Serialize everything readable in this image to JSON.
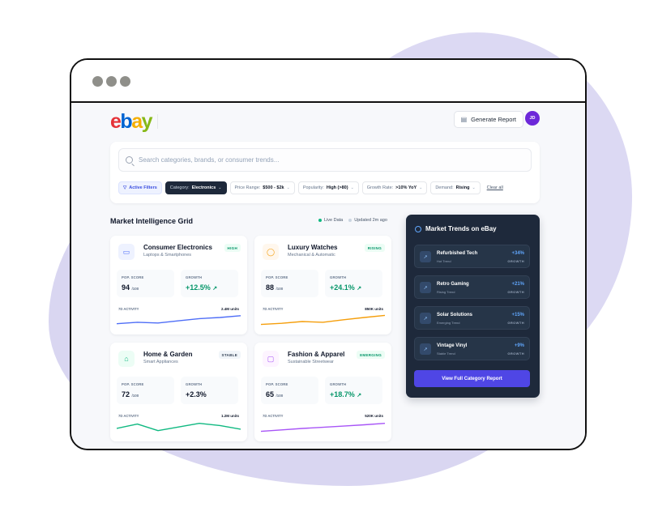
{
  "header": {
    "logo": {
      "e": "e",
      "b": "b",
      "a": "a",
      "y": "y"
    },
    "generate_report_label": "Generate Report",
    "avatar_initials": "JD"
  },
  "search": {
    "placeholder": "Search categories, brands, or consumer trends..."
  },
  "filters": {
    "active_label": "Active Filters",
    "items": [
      {
        "key": "Category:",
        "value": "Electronics"
      },
      {
        "key": "Price Range:",
        "value": "$500 - $2k"
      },
      {
        "key": "Popularity:",
        "value": "High (>80)"
      },
      {
        "key": "Growth Rate:",
        "value": ">10% YoY"
      },
      {
        "key": "Demand:",
        "value": "Rising"
      }
    ],
    "clear_label": "Clear all"
  },
  "grid": {
    "title": "Market Intelligence Grid",
    "live_label": "Live Data",
    "updated_label": "Updated 2m ago",
    "cards": [
      {
        "name": "Consumer Electronics",
        "sub": "Laptops & Smartphones",
        "badge": "HIGH",
        "pop_label": "POP. SCORE",
        "pop": "94",
        "pop_unit": "/100",
        "growth_label": "GROWTH",
        "growth": "+12.5%",
        "activity_label": "7D ACTIVITY",
        "activity": "2.4M units",
        "trend": [
          0.35,
          0.45,
          0.4,
          0.55,
          0.7,
          0.78,
          0.9
        ],
        "color": "#4f6ef7"
      },
      {
        "name": "Luxury Watches",
        "sub": "Mechanical & Automatic",
        "badge": "RISING",
        "pop_label": "POP. SCORE",
        "pop": "88",
        "pop_unit": "/100",
        "growth_label": "GROWTH",
        "growth": "+24.1%",
        "activity_label": "7D ACTIVITY",
        "activity": "850K units",
        "trend": [
          0.3,
          0.38,
          0.5,
          0.45,
          0.62,
          0.78,
          0.92
        ],
        "color": "#f59e0b"
      },
      {
        "name": "Home & Garden",
        "sub": "Smart Appliances",
        "badge": "STABLE",
        "pop_label": "POP. SCORE",
        "pop": "72",
        "pop_unit": "/100",
        "growth_label": "GROWTH",
        "growth": "+2.3%",
        "activity_label": "7D ACTIVITY",
        "activity": "1.2M units",
        "trend": [
          0.5,
          0.8,
          0.35,
          0.6,
          0.85,
          0.7,
          0.45
        ],
        "color": "#10b981"
      },
      {
        "name": "Fashion & Apparel",
        "sub": "Sustainable Streetwear",
        "badge": "EMERGING",
        "pop_label": "POP. SCORE",
        "pop": "65",
        "pop_unit": "/100",
        "growth_label": "GROWTH",
        "growth": "+18.7%",
        "activity_label": "7D ACTIVITY",
        "activity": "520K units",
        "trend": [
          0.3,
          0.4,
          0.5,
          0.58,
          0.66,
          0.75,
          0.85
        ],
        "color": "#a855f7"
      }
    ]
  },
  "trends": {
    "title": "Market Trends on eBay",
    "items": [
      {
        "name": "Refurbished Tech",
        "sub": "Hot Trend",
        "value": "+34%",
        "tag": "GROWTH"
      },
      {
        "name": "Retro Gaming",
        "sub": "Rising Trend",
        "value": "+21%",
        "tag": "GROWTH"
      },
      {
        "name": "Solar Solutions",
        "sub": "Emerging Trend",
        "value": "+15%",
        "tag": "GROWTH"
      },
      {
        "name": "Vintage Vinyl",
        "sub": "Stable Trend",
        "value": "+9%",
        "tag": "GROWTH"
      }
    ],
    "button_label": "View Full Category Report"
  }
}
